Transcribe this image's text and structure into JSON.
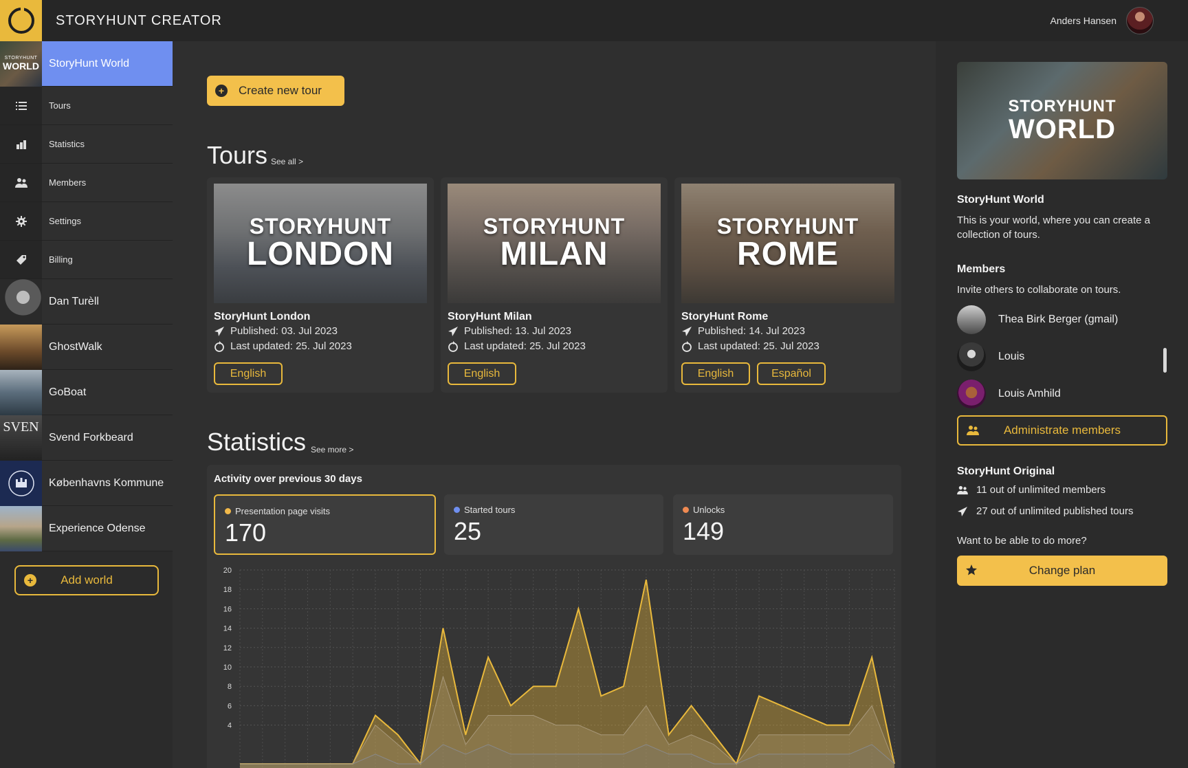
{
  "app": {
    "title": "STORYHUNT CREATOR",
    "user_name": "Anders Hansen"
  },
  "colors": {
    "accent": "#e9b93c",
    "active_world": "#6f8ff0",
    "presentation": "#f2b94a",
    "started": "#6f8ff0",
    "unlocks": "#ef8a52"
  },
  "sidebar": {
    "world": {
      "name": "StoryHunt World",
      "thumb_small": "STORYHUNT",
      "thumb_big": "WORLD"
    },
    "nav": [
      {
        "label": "Tours",
        "icon": "list-icon"
      },
      {
        "label": "Statistics",
        "icon": "bar-chart-icon"
      },
      {
        "label": "Members",
        "icon": "people-icon"
      },
      {
        "label": "Settings",
        "icon": "gear-icon"
      },
      {
        "label": "Billing",
        "icon": "tag-icon"
      }
    ],
    "worlds": [
      {
        "name": "Dan Turèll",
        "thumb_text": ""
      },
      {
        "name": "GhostWalk",
        "thumb_text": ""
      },
      {
        "name": "GoBoat",
        "thumb_text": ""
      },
      {
        "name": "Svend Forkbeard",
        "thumb_text": "SVEN"
      },
      {
        "name": "Københavns Kommune",
        "thumb_text": ""
      },
      {
        "name": "Experience Odense",
        "thumb_text": ""
      }
    ],
    "add_world_label": "Add world"
  },
  "main": {
    "create_tour_label": "Create new tour",
    "tours_title": "Tours",
    "tours_link": "See all >",
    "tours": [
      {
        "image_small": "STORYHUNT",
        "image_big": "LONDON",
        "name": "StoryHunt London",
        "published": "Published: 03. Jul 2023",
        "updated": "Last updated: 25. Jul 2023",
        "languages": [
          "English"
        ]
      },
      {
        "image_small": "STORYHUNT",
        "image_big": "MILAN",
        "name": "StoryHunt Milan",
        "published": "Published: 13. Jul 2023",
        "updated": "Last updated: 25. Jul 2023",
        "languages": [
          "English"
        ]
      },
      {
        "image_small": "STORYHUNT",
        "image_big": "ROME",
        "name": "StoryHunt Rome",
        "published": "Published: 14. Jul 2023",
        "updated": "Last updated: 25. Jul 2023",
        "languages": [
          "English",
          "Español"
        ]
      }
    ],
    "stats_title": "Statistics",
    "stats_link": "See more >",
    "stats_heading": "Activity over previous 30 days",
    "stat_boxes": [
      {
        "label": "Presentation page visits",
        "value": "170"
      },
      {
        "label": "Started tours",
        "value": "25"
      },
      {
        "label": "Unlocks",
        "value": "149"
      }
    ]
  },
  "chart_data": {
    "type": "area",
    "title": "Activity over previous 30 days",
    "xlabel": "",
    "ylabel": "",
    "ylim": [
      0,
      20
    ],
    "y_ticks": [
      20,
      18,
      16,
      14,
      12,
      10,
      8,
      6,
      4
    ],
    "grid": true,
    "x": [
      1,
      2,
      3,
      4,
      5,
      6,
      7,
      8,
      9,
      10,
      11,
      12,
      13,
      14,
      15,
      16,
      17,
      18,
      19,
      20,
      21,
      22,
      23,
      24,
      25,
      26,
      27,
      28,
      29,
      30
    ],
    "series": [
      {
        "name": "Presentation page visits",
        "values": [
          0,
          0,
          0,
          0,
          0,
          0,
          5,
          3,
          0,
          14,
          3,
          11,
          6,
          8,
          8,
          16,
          7,
          8,
          19,
          3,
          6,
          3,
          0,
          7,
          6,
          5,
          4,
          4,
          11,
          0
        ]
      },
      {
        "name": "Unlocks",
        "values": [
          0,
          0,
          0,
          0,
          0,
          0,
          4,
          2,
          0,
          9,
          2,
          5,
          5,
          5,
          4,
          4,
          3,
          3,
          6,
          2,
          3,
          2,
          0,
          3,
          3,
          3,
          3,
          3,
          6,
          0
        ]
      },
      {
        "name": "Started tours",
        "values": [
          0,
          0,
          0,
          0,
          0,
          0,
          1,
          0,
          0,
          2,
          1,
          2,
          1,
          1,
          1,
          1,
          1,
          1,
          2,
          1,
          1,
          0,
          0,
          1,
          1,
          1,
          1,
          1,
          2,
          0
        ]
      }
    ]
  },
  "right": {
    "world_img_small": "STORYHUNT",
    "world_img_big": "WORLD",
    "world_title": "StoryHunt World",
    "world_desc": "This is your world, where you can create a collection of tours.",
    "members_title": "Members",
    "members_desc": "Invite others to collaborate on tours.",
    "members": [
      {
        "name": "Thea Birk Berger (gmail)"
      },
      {
        "name": "Louis"
      },
      {
        "name": "Louis Amhild"
      }
    ],
    "admin_label": "Administrate members",
    "plan_title": "StoryHunt Original",
    "plan_members": "11 out of unlimited members",
    "plan_tours": "27 out of unlimited published tours",
    "more_question": "Want to be able to do more?",
    "change_plan_label": "Change plan"
  }
}
